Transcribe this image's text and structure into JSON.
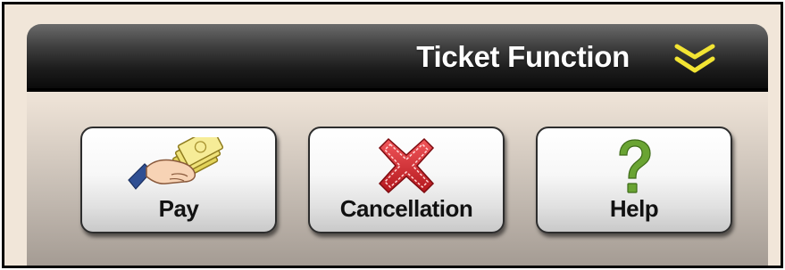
{
  "panel": {
    "title": "Ticket Function",
    "collapse_icon": "double-chevron-down-icon"
  },
  "buttons": [
    {
      "label": "Pay",
      "icon": "hand-with-money-icon"
    },
    {
      "label": "Cancellation",
      "icon": "red-x-icon"
    },
    {
      "label": "Help",
      "icon": "question-mark-icon"
    }
  ],
  "colors": {
    "header_text": "#ffffff",
    "chevron": "#f2e433",
    "cancel_red": "#d9252b",
    "help_green": "#6aa433"
  }
}
